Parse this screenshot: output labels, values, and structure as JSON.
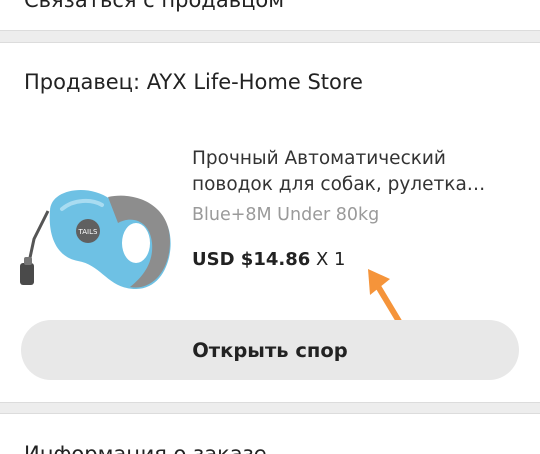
{
  "top_section": {
    "label": "Связаться с продавцом"
  },
  "seller": {
    "label": "Продавец: AYX Life-Home Store"
  },
  "product": {
    "title": "Прочный Автоматический поводок для собак, рулетка поводок для собак",
    "variant": "Blue+8M Under 80kg",
    "price": "USD $14.86",
    "quantity": "X 1",
    "image_icon": "retractable-dog-leash",
    "accent_color": "#6ec1e4"
  },
  "actions": {
    "open_dispute": "Открыть спор"
  },
  "bottom_section": {
    "label": "Информация о заказе"
  },
  "annotation": {
    "color": "#f5943a"
  }
}
